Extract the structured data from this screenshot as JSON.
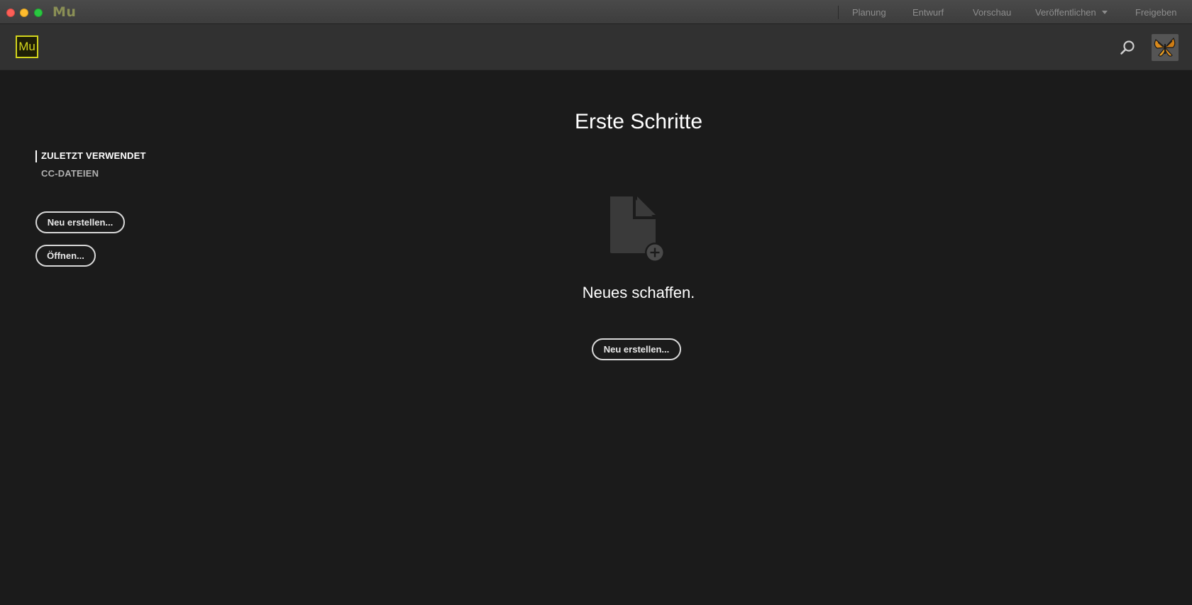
{
  "titlebar": {
    "app_name": "Mu",
    "menu": {
      "planung": "Planung",
      "entwurf": "Entwurf",
      "vorschau": "Vorschau",
      "veroeffentlichen": "Veröffentlichen",
      "freigeben": "Freigeben"
    }
  },
  "appbar": {
    "logo_text": "Mu",
    "accent_color": "#d3d51c"
  },
  "sidebar": {
    "items": [
      {
        "label": "ZULETZT VERWENDET",
        "active": true
      },
      {
        "label": "CC-DATEIEN",
        "active": false
      }
    ],
    "new_button": "Neu erstellen...",
    "open_button": "Öffnen..."
  },
  "main": {
    "title": "Erste Schritte",
    "heading": "Neues schaffen.",
    "new_button": "Neu erstellen..."
  },
  "icons": {
    "search": "search-icon",
    "document_add": "document-add-icon",
    "avatar": "butterfly-avatar"
  }
}
